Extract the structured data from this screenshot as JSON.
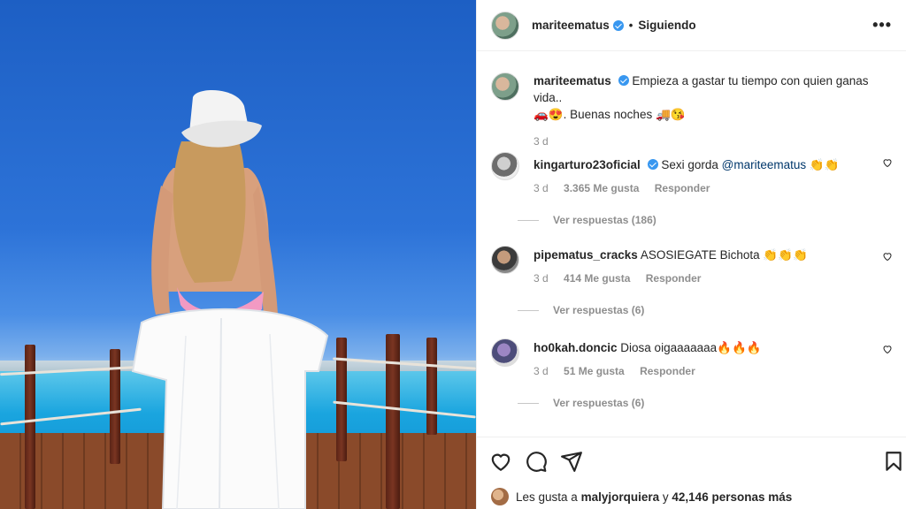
{
  "post": {
    "username": "mariteematus",
    "follow_status": "Siguiendo",
    "caption": "Empieza a gastar tu tiempo con quien ganas vida..",
    "caption_line2": ". Buenas noches",
    "caption_emoji_1": "🚗😍",
    "caption_emoji_2": "🚚😘",
    "time": "3 d"
  },
  "comments": [
    {
      "username": "kingarturo23oficial",
      "verified": true,
      "text": "Sexi gorda ",
      "mention": "@mariteematus",
      "emoji": "👏👏",
      "time": "3 d",
      "likes": "3.365 Me gusta",
      "reply": "Responder",
      "view_replies": "Ver respuestas (186)"
    },
    {
      "username": "pipematus_cracks",
      "verified": false,
      "text": "ASOSIEGATE Bichota ",
      "emoji": "👏👏👏",
      "time": "3 d",
      "likes": "414 Me gusta",
      "reply": "Responder",
      "view_replies": "Ver respuestas (6)"
    },
    {
      "username": "ho0kah.doncic",
      "verified": false,
      "text": "Diosa oigaaaaaaa",
      "emoji": "🔥🔥🔥",
      "time": "3 d",
      "likes": "51 Me gusta",
      "reply": "Responder",
      "view_replies": "Ver respuestas (6)"
    }
  ],
  "likes_line": {
    "prefix": "Les gusta a ",
    "user": "malyjorquiera",
    "middle": " y ",
    "count": "42,146 personas más"
  },
  "icons": {
    "more": "more-options-icon",
    "like": "heart-icon",
    "comment": "comment-icon",
    "share": "share-icon",
    "save": "bookmark-icon"
  },
  "colors": {
    "verified": "#3897f0",
    "mention": "#00376b",
    "secondary_text": "#8e8e8e"
  }
}
